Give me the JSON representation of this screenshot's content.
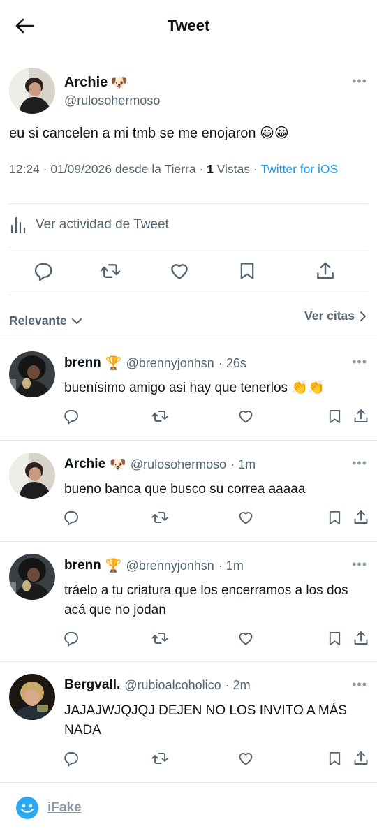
{
  "header": {
    "title": "Tweet"
  },
  "tweet": {
    "name": "Archie",
    "handle": "@rulosohermoso",
    "text": "eu si cancelen a mi tmb se me enojaron 😀😀",
    "time": "12:24",
    "date": "01/09/2026",
    "location": "desde la Tierra",
    "views_count": "1",
    "views_label": "Vistas",
    "source": "Twitter for iOS",
    "activity_label": "Ver actividad de Tweet"
  },
  "replies_bar": {
    "sort_label": "Relevante",
    "quotes_label": "Ver citas"
  },
  "replies": [
    {
      "name": "brenn",
      "handle": "@brennyjonhsn",
      "time": "26s",
      "text": "buenísimo amigo asi hay que tenerlos 👏👏"
    },
    {
      "name": "Archie",
      "handle": "@rulosohermoso",
      "time": "1m",
      "text": "bueno banca que busco su correa aaaaa"
    },
    {
      "name": "brenn",
      "handle": "@brennyjonhsn",
      "time": "1m",
      "text": "tráelo a tu criatura que los encerramos a los dos acá que no jodan"
    },
    {
      "name": "Bergvall.",
      "handle": "@rubioalcoholico",
      "time": "2m",
      "text": "JAJAJWJQJQJ DEJEN NO LOS INVITO A MÁS NADA"
    }
  ],
  "footer": {
    "label": "iFake"
  },
  "icons": [
    "back-arrow-icon",
    "more-icon",
    "bar-chart-icon",
    "reply-icon",
    "retweet-icon",
    "like-icon",
    "bookmark-icon",
    "share-icon",
    "chevron-down-icon",
    "chevron-right-icon",
    "dog-emoji-icon",
    "trophy-emoji-icon",
    "ifake-logo-icon"
  ],
  "colors": {
    "accent": "#1d9bf0",
    "text": "#0f1419",
    "secondary": "#536471",
    "divider": "#e1e6ea"
  }
}
